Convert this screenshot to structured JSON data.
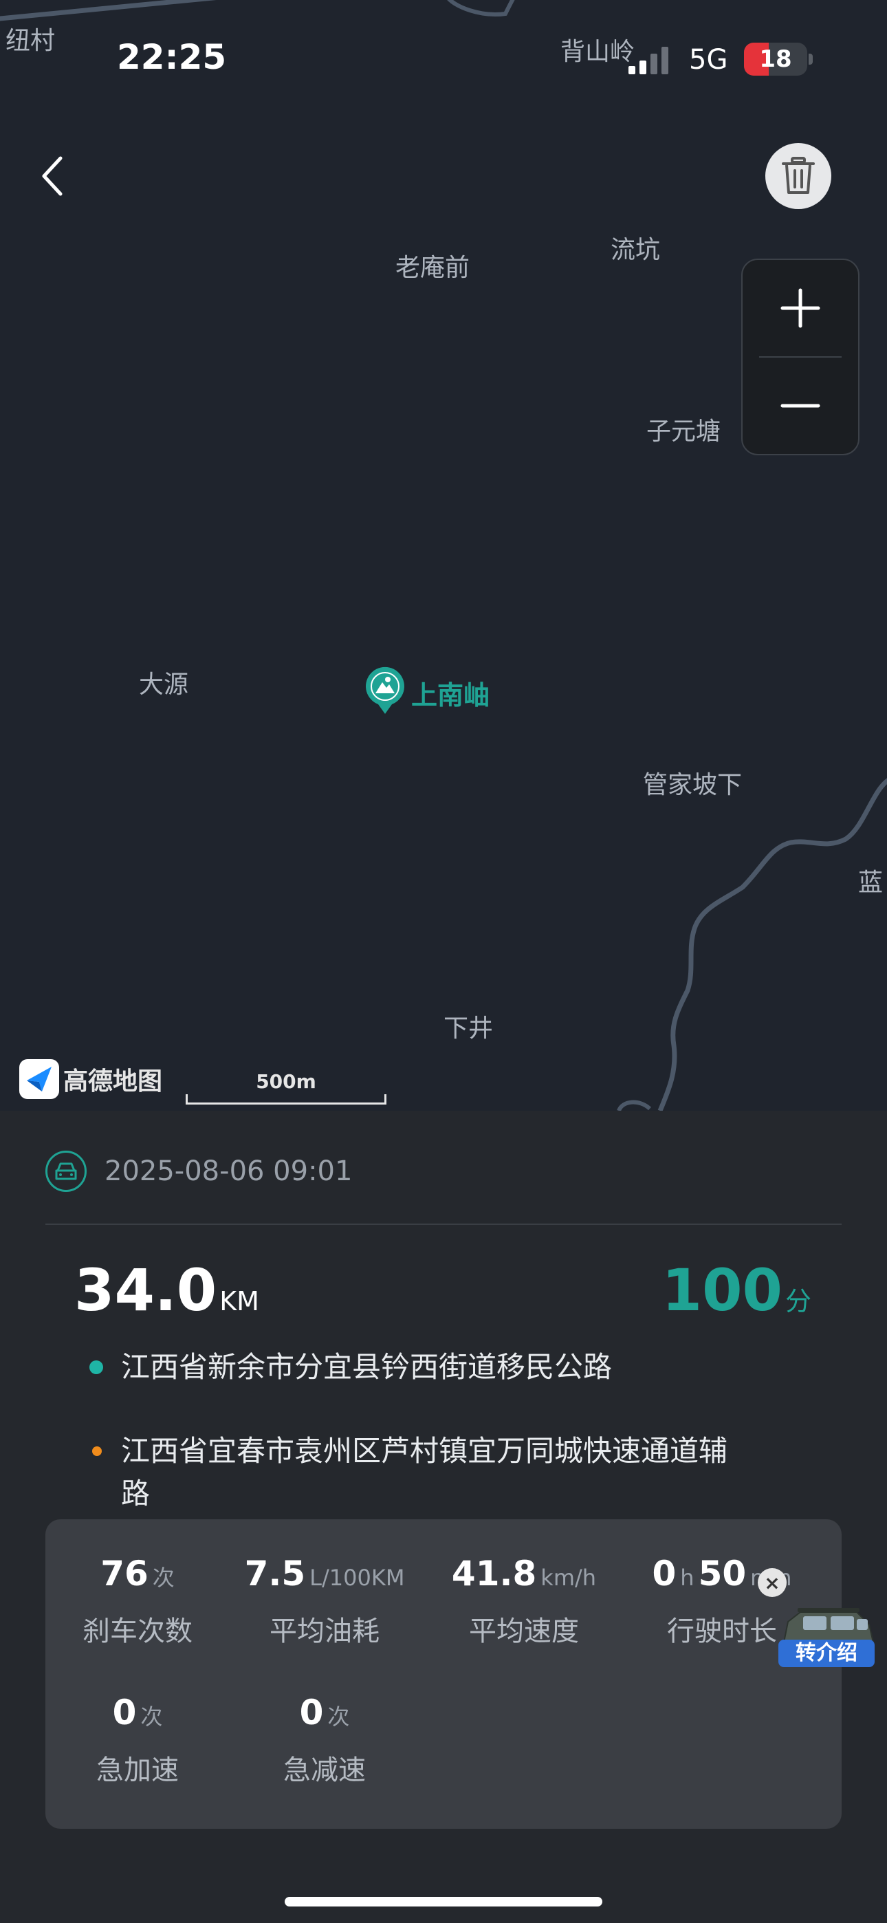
{
  "status_bar": {
    "time": "22:25",
    "network": "5G",
    "battery": "18",
    "battery_level": 0.18
  },
  "map": {
    "places": [
      "纽村",
      "背山岭",
      "老庵前",
      "流坑",
      "子元塘",
      "大源",
      "管家坡下",
      "蓝",
      "下井"
    ],
    "poi_label": "上南岫",
    "provider": "高德地图",
    "scale_label": "500m",
    "icons": {
      "back": "chevron-left-icon",
      "delete": "trash-icon",
      "zoom_in": "plus-icon",
      "zoom_out": "minus-icon",
      "poi": "scenic-pin-icon"
    }
  },
  "trip": {
    "datetime": "2025-08-06 09:01",
    "distance": "34.0",
    "distance_unit": "KM",
    "score": "100",
    "score_unit": "分",
    "start_address": "江西省新余市分宜县钤西街道移民公路",
    "end_address_line1": "江西省宜春市袁州区芦村镇宜万同城快速通道辅",
    "end_address_line2": "路",
    "colors": {
      "accent": "#1fa394",
      "start_dot": "#1fb5a6",
      "end_dot": "#f08c1c"
    }
  },
  "stats": [
    {
      "value": "76",
      "unit": "次",
      "label": "刹车次数"
    },
    {
      "value": "7.5",
      "unit": "L/100KM",
      "label": "平均油耗"
    },
    {
      "value": "41.8",
      "unit": "km/h",
      "label": "平均速度"
    },
    {
      "value": "0",
      "unit": "h",
      "value2": "50",
      "unit2": "min",
      "label": "行驶时长"
    },
    {
      "value": "0",
      "unit": "次",
      "label": "急加速"
    },
    {
      "value": "0",
      "unit": "次",
      "label": "急减速"
    }
  ],
  "ad": {
    "label": "转介绍",
    "close": "×"
  }
}
